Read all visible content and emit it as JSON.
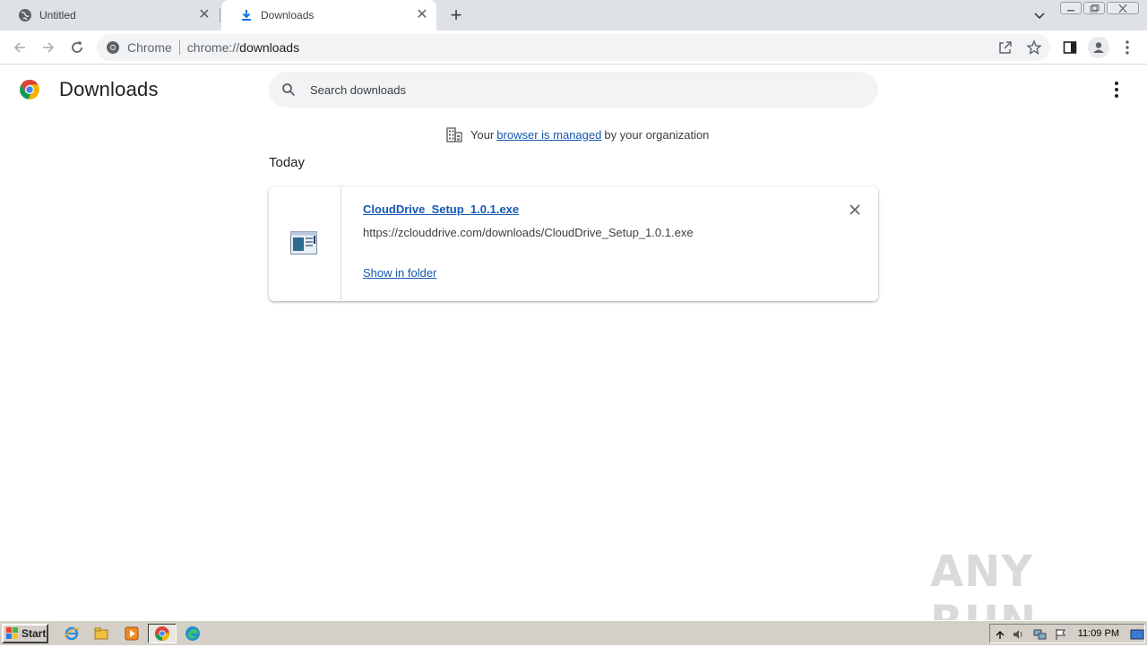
{
  "browser": {
    "tabs": [
      {
        "title": "Untitled",
        "active": false,
        "icon": "globe-icon"
      },
      {
        "title": "Downloads",
        "active": true,
        "icon": "download-icon"
      }
    ],
    "omnibox": {
      "chip_label": "Chrome",
      "url_scheme": "chrome://",
      "url_host": "downloads"
    }
  },
  "downloads_page": {
    "title": "Downloads",
    "search_placeholder": "Search downloads",
    "managed_notice": {
      "prefix": "Your",
      "link": "browser is managed",
      "suffix": "by your organization"
    },
    "section_label": "Today",
    "items": [
      {
        "file_name": "CloudDrive_Setup_1.0.1.exe",
        "url": "https://zclouddrive.com/downloads/CloudDrive_Setup_1.0.1.exe",
        "action": "Show in folder"
      }
    ]
  },
  "watermark": "ANY RUN",
  "taskbar": {
    "start_label": "Start",
    "clock": "11:09 PM",
    "apps": [
      "ie-icon",
      "explorer-icon",
      "media-player-icon",
      "chrome-icon",
      "edge-icon"
    ]
  },
  "colors": {
    "accent": "#1558b0",
    "tabstrip": "#dee1e6",
    "omnibox": "#f1f3f4",
    "taskbar": "#d4d0c8"
  }
}
